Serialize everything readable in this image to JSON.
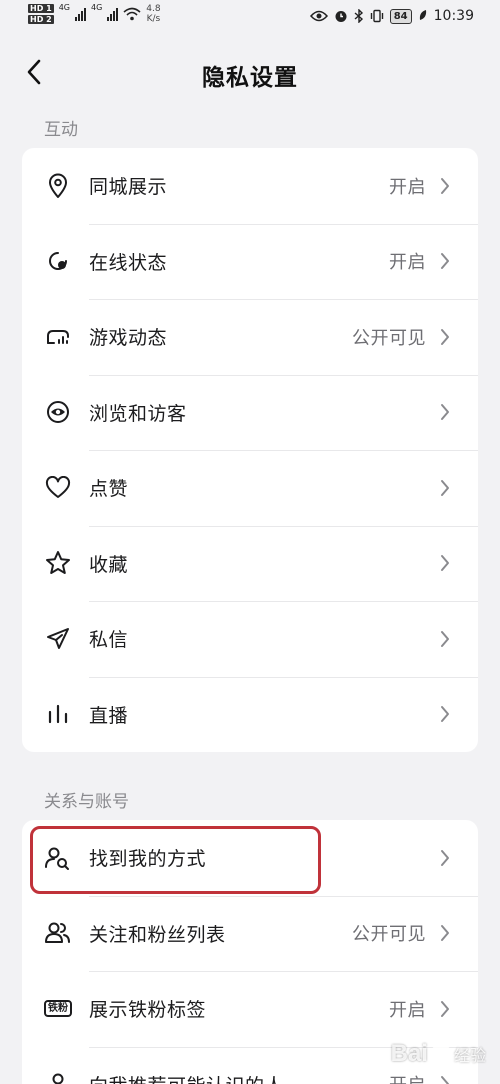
{
  "status_bar": {
    "hd1": "HD 1",
    "hd2": "HD 2",
    "net1": "4G",
    "net2": "4G",
    "speed_value": "4.8",
    "speed_unit": "K/s",
    "battery": "84",
    "time": "10:39"
  },
  "header": {
    "title": "隐私设置"
  },
  "sections": {
    "interaction": {
      "label": "互动",
      "items": [
        {
          "label": "同城展示",
          "value": "开启",
          "icon": "location-pin-icon"
        },
        {
          "label": "在线状态",
          "value": "开启",
          "icon": "online-status-icon"
        },
        {
          "label": "游戏动态",
          "value": "公开可见",
          "icon": "gamepad-icon"
        },
        {
          "label": "浏览和访客",
          "value": "",
          "icon": "eye-icon"
        },
        {
          "label": "点赞",
          "value": "",
          "icon": "heart-icon"
        },
        {
          "label": "收藏",
          "value": "",
          "icon": "star-icon"
        },
        {
          "label": "私信",
          "value": "",
          "icon": "paper-plane-icon"
        },
        {
          "label": "直播",
          "value": "",
          "icon": "live-bars-icon"
        }
      ]
    },
    "account": {
      "label": "关系与账号",
      "items": [
        {
          "label": "找到我的方式",
          "value": "",
          "icon": "find-user-icon"
        },
        {
          "label": "关注和粉丝列表",
          "value": "公开可见",
          "icon": "users-icon"
        },
        {
          "label": "展示铁粉标签",
          "value": "开启",
          "icon": "fan-badge-icon",
          "badge_text": "铁粉"
        },
        {
          "label": "向我推荐可能认识的人",
          "value": "开启",
          "icon": "person-icon"
        }
      ]
    }
  },
  "watermark": {
    "brand": "Bai",
    "suffix": "经验"
  }
}
